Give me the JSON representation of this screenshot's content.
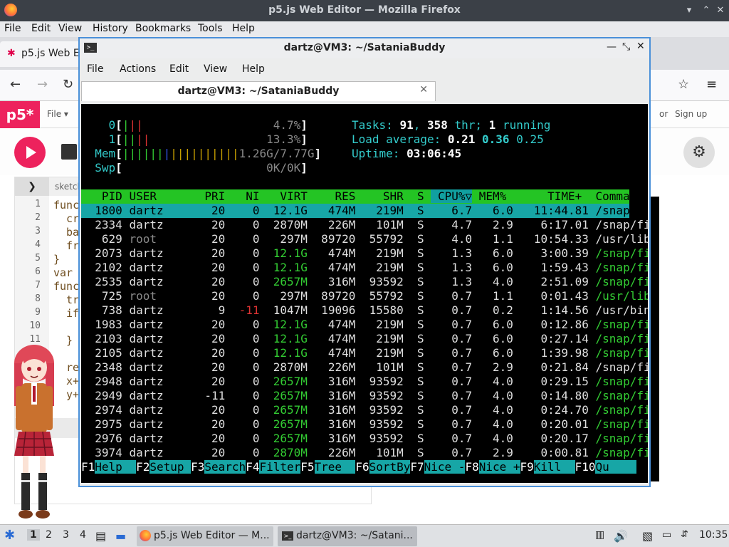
{
  "firefox": {
    "title": "p5.js Web Editor — Mozilla Firefox",
    "menu": [
      "File",
      "Edit",
      "View",
      "History",
      "Bookmarks",
      "Tools",
      "Help"
    ],
    "tab_label": "p5.js Web E",
    "sketch_name": "sketch"
  },
  "p5": {
    "logo": "p5*",
    "file_menu": "File ▾",
    "or": "or",
    "signup": "Sign up",
    "line_numbers": [
      "1",
      "2",
      "3",
      "4",
      "5",
      "6",
      "7",
      "8",
      "9",
      "10",
      "11"
    ],
    "code": [
      "func",
      "cr",
      "ba",
      "fr",
      "}",
      "var",
      "func",
      "tr",
      "if",
      "",
      "}",
      "re",
      "x+",
      "y+"
    ]
  },
  "terminal": {
    "title": "dartz@VM3: ~/SataniaBuddy",
    "menu": [
      "File",
      "Actions",
      "Edit",
      "View",
      "Help"
    ],
    "tab_title": "dartz@VM3: ~/SataniaBuddy",
    "meters": {
      "cpu0": "4.7%",
      "cpu1": "13.3%",
      "mem": "1.26G/7.77G",
      "swp": "0K/0K",
      "tasks": "91",
      "threads": "358",
      "running": "1",
      "load1": "0.21",
      "load5": "0.36",
      "load15": "0.25",
      "uptime": "03:06:45"
    },
    "columns": [
      "PID",
      "USER",
      "PRI",
      "NI",
      "VIRT",
      "RES",
      "SHR",
      "S",
      "CPU%▽",
      "MEM%",
      "TIME+",
      "Command"
    ],
    "rows": [
      [
        "1800",
        "dartz",
        "20",
        "0",
        "12.1G",
        "474M",
        "219M",
        "S",
        "6.7",
        "6.0",
        "11:44.81",
        "/snap/firefo"
      ],
      [
        "2334",
        "dartz",
        "20",
        "0",
        "2870M",
        "226M",
        "101M",
        "S",
        "4.7",
        "2.9",
        "6:17.01",
        "/snap/firefo"
      ],
      [
        "629",
        "root",
        "20",
        "0",
        "297M",
        "89720",
        "55792",
        "S",
        "4.0",
        "1.1",
        "10:54.33",
        "/usr/lib/xor"
      ],
      [
        "2073",
        "dartz",
        "20",
        "0",
        "12.1G",
        "474M",
        "219M",
        "S",
        "1.3",
        "6.0",
        "3:00.39",
        "/snap/firefo"
      ],
      [
        "2102",
        "dartz",
        "20",
        "0",
        "12.1G",
        "474M",
        "219M",
        "S",
        "1.3",
        "6.0",
        "1:59.43",
        "/snap/firefo"
      ],
      [
        "2535",
        "dartz",
        "20",
        "0",
        "2657M",
        "316M",
        "93592",
        "S",
        "1.3",
        "4.0",
        "2:51.09",
        "/snap/firefo"
      ],
      [
        "725",
        "root",
        "20",
        "0",
        "297M",
        "89720",
        "55792",
        "S",
        "0.7",
        "1.1",
        "0:01.43",
        "/usr/lib/xor"
      ],
      [
        "738",
        "dartz",
        "9",
        "-11",
        "1047M",
        "19096",
        "15580",
        "S",
        "0.7",
        "0.2",
        "1:14.56",
        "/usr/bin/pul"
      ],
      [
        "1983",
        "dartz",
        "20",
        "0",
        "12.1G",
        "474M",
        "219M",
        "S",
        "0.7",
        "6.0",
        "0:12.86",
        "/snap/firefo"
      ],
      [
        "2103",
        "dartz",
        "20",
        "0",
        "12.1G",
        "474M",
        "219M",
        "S",
        "0.7",
        "6.0",
        "0:27.14",
        "/snap/firefo"
      ],
      [
        "2105",
        "dartz",
        "20",
        "0",
        "12.1G",
        "474M",
        "219M",
        "S",
        "0.7",
        "6.0",
        "1:39.98",
        "/snap/firefo"
      ],
      [
        "2348",
        "dartz",
        "20",
        "0",
        "2870M",
        "226M",
        "101M",
        "S",
        "0.7",
        "2.9",
        "0:21.84",
        "/snap/firefo"
      ],
      [
        "2948",
        "dartz",
        "20",
        "0",
        "2657M",
        "316M",
        "93592",
        "S",
        "0.7",
        "4.0",
        "0:29.15",
        "/snap/firefo"
      ],
      [
        "2949",
        "dartz",
        "-11",
        "0",
        "2657M",
        "316M",
        "93592",
        "S",
        "0.7",
        "4.0",
        "0:14.80",
        "/snap/firefo"
      ],
      [
        "2974",
        "dartz",
        "20",
        "0",
        "2657M",
        "316M",
        "93592",
        "S",
        "0.7",
        "4.0",
        "0:24.70",
        "/snap/firefo"
      ],
      [
        "2975",
        "dartz",
        "20",
        "0",
        "2657M",
        "316M",
        "93592",
        "S",
        "0.7",
        "4.0",
        "0:20.01",
        "/snap/firefo"
      ],
      [
        "2976",
        "dartz",
        "20",
        "0",
        "2657M",
        "316M",
        "93592",
        "S",
        "0.7",
        "4.0",
        "0:20.17",
        "/snap/firefo"
      ],
      [
        "3974",
        "dartz",
        "20",
        "0",
        "2870M",
        "226M",
        "101M",
        "S",
        "0.7",
        "2.9",
        "0:00.81",
        "/snap/firefo"
      ]
    ],
    "fkeys": [
      [
        "F1",
        "Help"
      ],
      [
        "F2",
        "Setup"
      ],
      [
        "F3",
        "Search"
      ],
      [
        "F4",
        "Filter"
      ],
      [
        "F5",
        "Tree"
      ],
      [
        "F6",
        "SortBy"
      ],
      [
        "F7",
        "Nice -"
      ],
      [
        "F8",
        "Nice +"
      ],
      [
        "F9",
        "Kill"
      ],
      [
        "F10",
        "Qu"
      ]
    ]
  },
  "taskbar": {
    "workspaces": [
      "1",
      "2",
      "3",
      "4"
    ],
    "task1": "p5.js Web Editor — M...",
    "task2": "dartz@VM3: ~/Satani...",
    "clock": "10:35"
  }
}
